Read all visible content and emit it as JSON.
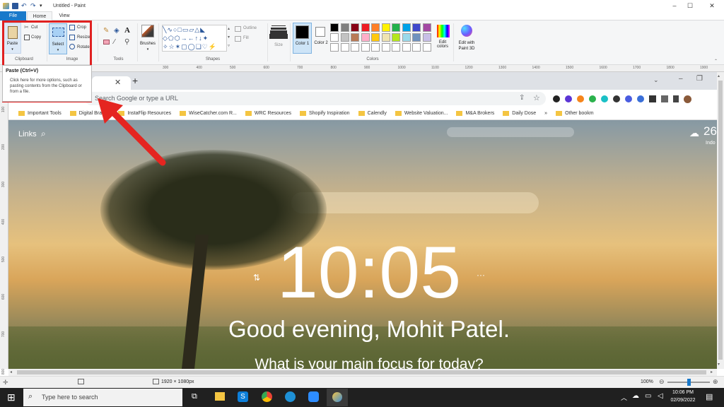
{
  "window": {
    "title": "Untitled - Paint",
    "minimize": "–",
    "maximize": "☐",
    "close": "✕"
  },
  "tabs": {
    "file": "File",
    "home": "Home",
    "view": "View"
  },
  "ribbon": {
    "clipboard": {
      "paste": "Paste",
      "cut": "Cut",
      "copy": "Copy",
      "label": "Clipboard"
    },
    "image": {
      "select": "Select",
      "crop": "Crop",
      "resize": "Resize",
      "rotate": "Rotate",
      "label": "Image"
    },
    "tools": {
      "label": "Tools"
    },
    "brushes": {
      "label": "Brushes"
    },
    "shapes": {
      "outline": "Outline",
      "fill": "Fill",
      "label": "Shapes"
    },
    "size": {
      "label": "Size"
    },
    "colors": {
      "color1": "Color 1",
      "color2": "Color 2",
      "edit_colors": "Edit colors",
      "edit_paint3d": "Edit with Paint 3D",
      "label": "Colors",
      "palette_row1": [
        "#000000",
        "#7f7f7f",
        "#880015",
        "#ed1c24",
        "#ff7f27",
        "#fff200",
        "#22b14c",
        "#00a2e8",
        "#3f48cc",
        "#a349a4"
      ],
      "palette_row2": [
        "#ffffff",
        "#c3c3c3",
        "#b97a57",
        "#ffaec9",
        "#ffc90e",
        "#efe4b0",
        "#b5e61d",
        "#99d9ea",
        "#7092be",
        "#c8bfe7"
      ]
    }
  },
  "tooltip": {
    "title": "Paste (Ctrl+V)",
    "body": "Click here for more options, such as pasting contents from the Clipboard or from a file."
  },
  "ruler": {
    "marks": [
      "300",
      "400",
      "500",
      "600",
      "700",
      "800",
      "900",
      "1000",
      "1100",
      "1200",
      "1300",
      "1400",
      "1500",
      "1600",
      "1700",
      "1800",
      "1900"
    ]
  },
  "vruler": {
    "marks": [
      "100",
      "200",
      "300",
      "400",
      "500",
      "600",
      "700",
      "800"
    ]
  },
  "browser": {
    "new_tab": "+",
    "omnibox_placeholder": "Search Google or type a URL",
    "bookmarks": [
      "Important Tools",
      "Digital Brands",
      "InstaFlip Resources",
      "WiseCatcher.com R...",
      "WRC Resources",
      "Shopify Inspiration",
      "Calendly",
      "Website Valuation...",
      "M&A Brokers",
      "Daily Dose",
      "Other bookm"
    ],
    "bookmarks_more": "»"
  },
  "momentum": {
    "links": "Links",
    "weather_temp": "26",
    "weather_loc": "Indo",
    "time": "10:05",
    "greeting": "Good evening, Mohit Patel.",
    "focus": "What is your main focus for today?",
    "more": "···"
  },
  "statusbar": {
    "dimensions": "1920 × 1080px",
    "zoom": "100%"
  },
  "taskbar": {
    "search": "Type here to search",
    "time": "10:06 PM",
    "date": "02/09/2022"
  }
}
